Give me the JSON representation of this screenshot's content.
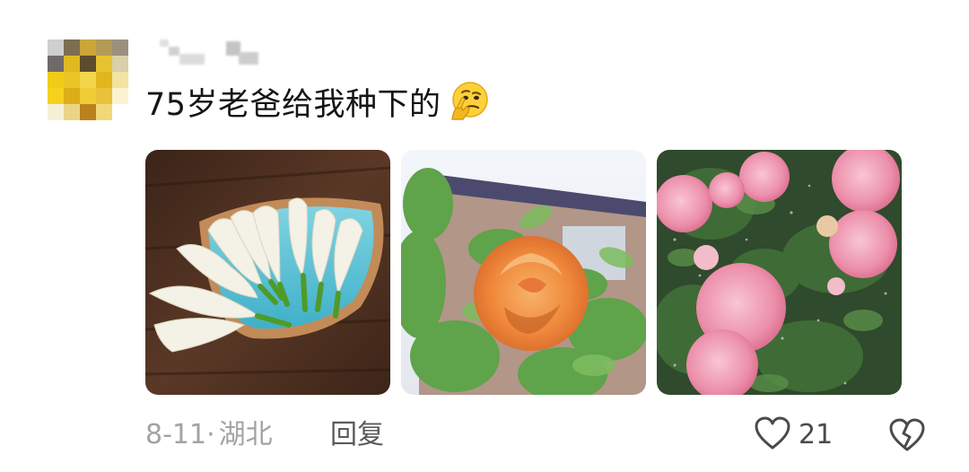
{
  "comment": {
    "text": "75岁老爸给我种下的",
    "emoji": "thinking-face-icon",
    "date": "8-11",
    "separator": "·",
    "location": "湖北",
    "reply_label": "回复",
    "like_count": "21",
    "photos": [
      {
        "name": "white-flowers-on-plate"
      },
      {
        "name": "orange-rose"
      },
      {
        "name": "pink-roses"
      }
    ]
  },
  "colors": {
    "meta_gray": "#a3a3a3",
    "icon_gray": "#4a4a4a",
    "avatar_yellow": "#e8c21a"
  }
}
